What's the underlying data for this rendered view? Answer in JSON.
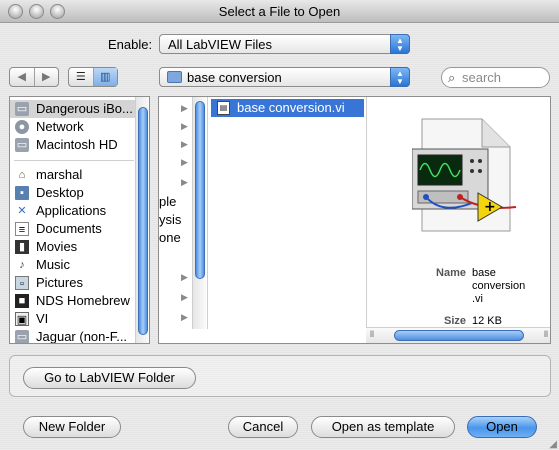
{
  "window": {
    "title": "Select a File to Open"
  },
  "enable": {
    "label": "Enable:",
    "value": "All LabVIEW Files"
  },
  "location": {
    "value": "base conversion"
  },
  "search": {
    "placeholder": "search"
  },
  "sidebar": {
    "devices": [
      {
        "label": "Dangerous iBo...",
        "icon": "hard-drive-icon"
      },
      {
        "label": "Network",
        "icon": "network-icon"
      },
      {
        "label": "Macintosh HD",
        "icon": "hard-drive-icon"
      }
    ],
    "places": [
      {
        "label": "marshal",
        "icon": "home-icon"
      },
      {
        "label": "Desktop",
        "icon": "desktop-icon"
      },
      {
        "label": "Applications",
        "icon": "applications-icon"
      },
      {
        "label": "Documents",
        "icon": "documents-icon"
      },
      {
        "label": "Movies",
        "icon": "movies-icon"
      },
      {
        "label": "Music",
        "icon": "music-icon"
      },
      {
        "label": "Pictures",
        "icon": "pictures-icon"
      },
      {
        "label": "NDS Homebrew",
        "icon": "folder-icon"
      },
      {
        "label": "VI",
        "icon": "folder-icon"
      },
      {
        "label": "Jaguar (non-F...",
        "icon": "hard-drive-icon"
      }
    ]
  },
  "browser": {
    "partial_column": [
      "ple",
      "ysis",
      "one"
    ],
    "file": {
      "name": "base conversion.vi",
      "icon": "labview-vi-icon"
    },
    "preview": {
      "name_label": "Name",
      "name_value_line1": "base",
      "name_value_line2": "conversion",
      "name_value_line3": ".vi",
      "size_label": "Size",
      "size_value": "12 KB"
    }
  },
  "buttons": {
    "goto_labview": "Go to LabVIEW Folder",
    "new_folder": "New Folder",
    "cancel": "Cancel",
    "open_template": "Open as template",
    "open": "Open"
  },
  "colors": {
    "selection": "#3875d7",
    "accent": "#4a95ea"
  }
}
